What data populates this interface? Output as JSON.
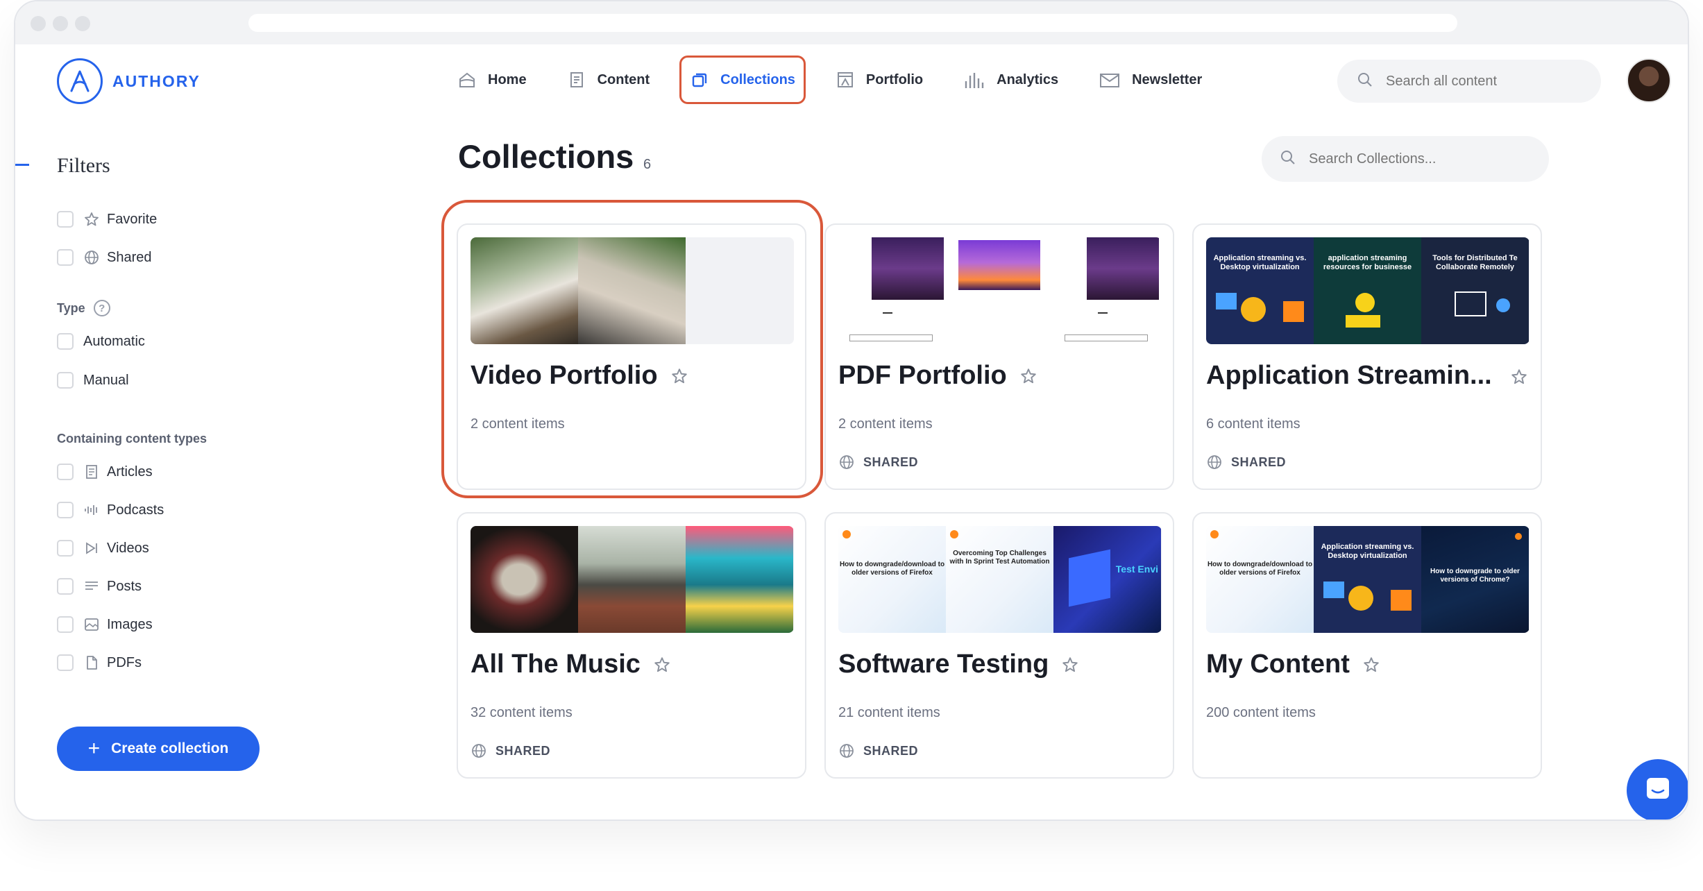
{
  "app": {
    "brand": "AUTHORY",
    "accent": "#2563eb",
    "highlight": "#d9583a"
  },
  "nav": [
    {
      "label": "Home",
      "icon": "home-icon"
    },
    {
      "label": "Content",
      "icon": "content-icon"
    },
    {
      "label": "Collections",
      "icon": "collections-icon",
      "active": true
    },
    {
      "label": "Portfolio",
      "icon": "portfolio-icon"
    },
    {
      "label": "Analytics",
      "icon": "analytics-icon"
    },
    {
      "label": "Newsletter",
      "icon": "newsletter-icon"
    }
  ],
  "top_search": {
    "placeholder": "Search all content"
  },
  "sidebar": {
    "title": "Filters",
    "quick": [
      {
        "label": "Favorite",
        "icon": "star-icon"
      },
      {
        "label": "Shared",
        "icon": "globe-icon"
      }
    ],
    "type_label": "Type",
    "types": [
      {
        "label": "Automatic"
      },
      {
        "label": "Manual"
      }
    ],
    "content_types_label": "Containing content types",
    "content_types": [
      {
        "label": "Articles",
        "icon": "article-icon"
      },
      {
        "label": "Podcasts",
        "icon": "podcast-icon"
      },
      {
        "label": "Videos",
        "icon": "video-icon"
      },
      {
        "label": "Posts",
        "icon": "post-icon"
      },
      {
        "label": "Images",
        "icon": "image-icon"
      },
      {
        "label": "PDFs",
        "icon": "pdf-icon"
      }
    ],
    "create_label": "Create collection"
  },
  "main": {
    "title": "Collections",
    "count": "6",
    "search_placeholder": "Search Collections...",
    "cards": [
      {
        "title": "Video Portfolio",
        "count": "2 content items",
        "shared": "",
        "highlighted": true
      },
      {
        "title": "PDF Portfolio",
        "count": "2 content items",
        "shared": "SHARED"
      },
      {
        "title": "Application Streamin...",
        "count": "6 content items",
        "shared": "SHARED"
      },
      {
        "title": "All The Music",
        "count": "32 content items",
        "shared": "SHARED"
      },
      {
        "title": "Software Testing",
        "count": "21 content items",
        "shared": "SHARED"
      },
      {
        "title": "My Content",
        "count": "200 content items",
        "shared": ""
      }
    ],
    "thumb_texts": {
      "app_stream_1": "Application streaming vs. Desktop virtualization",
      "app_stream_2": "application streaming resources for businesse",
      "app_stream_3": "Tools for Distributed Te Collaborate Remotely",
      "downgrade_firefox": "How to downgrade/download to older versions of Firefox",
      "sprint": "Overcoming Top Challenges with In Sprint Test Automation",
      "test_env": "Test Envi",
      "downgrade_chrome": "How to downgrade to older versions of Chrome?"
    }
  }
}
